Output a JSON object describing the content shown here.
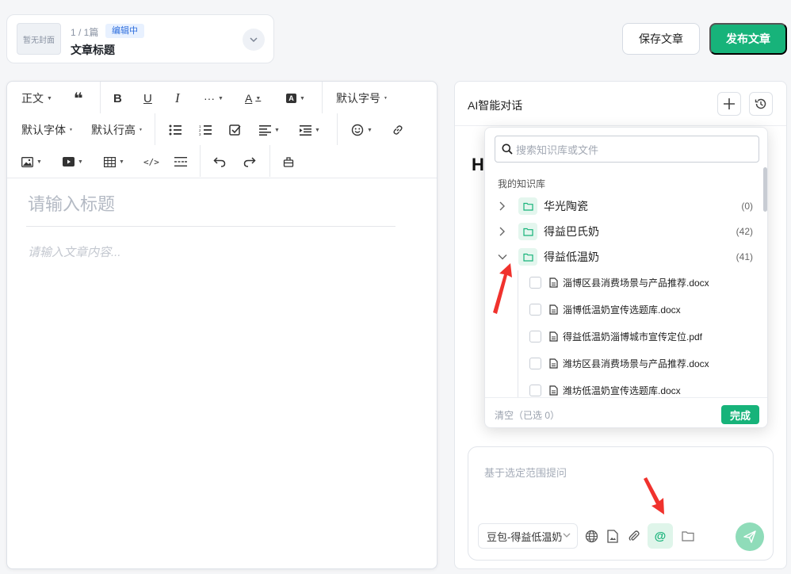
{
  "doc": {
    "cover_label": "暂无封面",
    "count": "1 / 1篇",
    "status": "编辑中",
    "title": "文章标题"
  },
  "actions": {
    "save": "保存文章",
    "publish": "发布文章"
  },
  "toolbar": {
    "paragraph": "正文",
    "font_size": "默认字号",
    "font_family": "默认字体",
    "line_height": "默认行高",
    "more": "···",
    "font_color": "A"
  },
  "editor": {
    "title_placeholder": "请输入标题",
    "content_placeholder": "请输入文章内容..."
  },
  "ai": {
    "title": "AI智能对话",
    "greeting": "H",
    "input_placeholder": "基于选定范围提问",
    "model": "豆包-得益低温奶"
  },
  "kb_picker": {
    "search_placeholder": "搜索知识库或文件",
    "section": "我的知识库",
    "libraries": [
      {
        "name": "华光陶瓷",
        "count": "(0)"
      },
      {
        "name": "得益巴氏奶",
        "count": "(42)"
      },
      {
        "name": "得益低温奶",
        "count": "(41)"
      }
    ],
    "files": [
      "淄博区县消费场景与产品推荐.docx",
      "淄博低温奶宣传选题库.docx",
      "得益低温奶淄博城市宣传定位.pdf",
      "潍坊区县消费场景与产品推荐.docx",
      "潍坊低温奶宣传选题库.docx"
    ],
    "clear_label": "清空（已选 0）",
    "done_label": "完成"
  },
  "colors": {
    "accent": "#17b37a",
    "annotation": "#f0322d"
  }
}
